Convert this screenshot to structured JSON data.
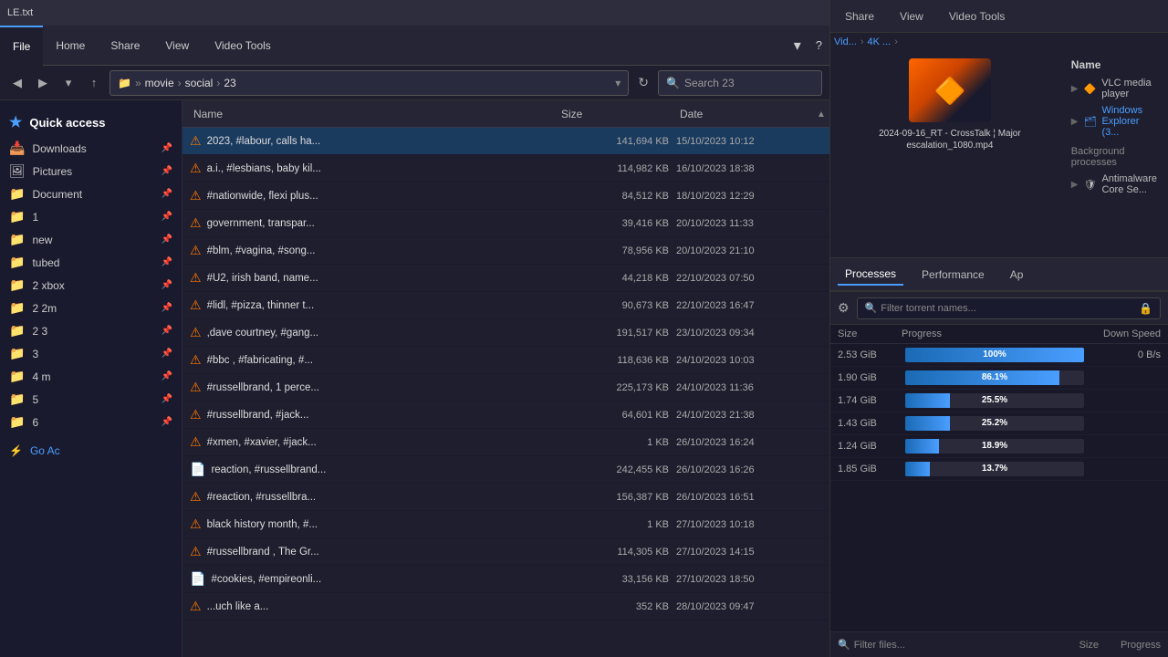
{
  "ribbon": {
    "file_tab": "File",
    "home_tab": "Home",
    "share_tab": "Share",
    "view_tab": "View",
    "videotools_tab": "Video Tools"
  },
  "addressbar": {
    "path_root": "movie",
    "path_seg1": "social",
    "path_seg2": "23",
    "search_placeholder": "Search 23",
    "search_label": "Search 23"
  },
  "sidebar": {
    "quick_access_label": "Quick access",
    "items": [
      {
        "label": "Downloads",
        "icon": "📥",
        "pinned": true
      },
      {
        "label": "Pictures",
        "icon": "🖼",
        "pinned": true
      },
      {
        "label": "Document",
        "icon": "📁",
        "pinned": true
      },
      {
        "label": "1",
        "icon": "📁",
        "pinned": true
      },
      {
        "label": "new",
        "icon": "📁",
        "pinned": true
      },
      {
        "label": "tubed",
        "icon": "📁",
        "pinned": true
      },
      {
        "label": "2 xbox",
        "icon": "📁",
        "pinned": true
      },
      {
        "label": "2 2m",
        "icon": "📁",
        "pinned": true
      },
      {
        "label": "2 3",
        "icon": "📁",
        "pinned": true
      },
      {
        "label": "3",
        "icon": "📁",
        "pinned": true
      },
      {
        "label": "4 m",
        "icon": "📁",
        "pinned": true
      },
      {
        "label": "5",
        "icon": "📁",
        "pinned": true
      },
      {
        "label": "6",
        "icon": "📁",
        "pinned": true
      }
    ],
    "go_ac_label": "Go Ac"
  },
  "file_list": {
    "col_name": "Name",
    "col_size": "Size",
    "col_date": "Date",
    "files": [
      {
        "name": "2023, #labour, calls ha...",
        "icon": "vlc",
        "size": "141,694 KB",
        "date": "15/10/2023 10:12",
        "selected": true
      },
      {
        "name": "a.i., #lesbians, baby kil...",
        "icon": "vlc",
        "size": "114,982 KB",
        "date": "16/10/2023 18:38",
        "selected": false
      },
      {
        "name": "#nationwide, flexi plus...",
        "icon": "vlc",
        "size": "84,512 KB",
        "date": "18/10/2023 12:29",
        "selected": false
      },
      {
        "name": "government, transpar...",
        "icon": "vlc",
        "size": "39,416 KB",
        "date": "20/10/2023 11:33",
        "selected": false
      },
      {
        "name": "#blm, #vagina, #song...",
        "icon": "vlc",
        "size": "78,956 KB",
        "date": "20/10/2023 21:10",
        "selected": false
      },
      {
        "name": "#U2, irish band, name...",
        "icon": "vlc",
        "size": "44,218 KB",
        "date": "22/10/2023 07:50",
        "selected": false
      },
      {
        "name": "#lidl, #pizza, thinner t...",
        "icon": "vlc",
        "size": "90,673 KB",
        "date": "22/10/2023 16:47",
        "selected": false
      },
      {
        "name": ",dave courtney, #gang...",
        "icon": "vlc",
        "size": "191,517 KB",
        "date": "23/10/2023 09:34",
        "selected": false
      },
      {
        "name": "#bbc , #fabricating, #...",
        "icon": "vlc",
        "size": "118,636 KB",
        "date": "24/10/2023 10:03",
        "selected": false
      },
      {
        "name": "#russellbrand, 1 perce...",
        "icon": "vlc",
        "size": "225,173 KB",
        "date": "24/10/2023 11:36",
        "selected": false
      },
      {
        "name": "#russellbrand, #jack...",
        "icon": "vlc",
        "size": "64,601 KB",
        "date": "24/10/2023 21:38",
        "selected": false
      },
      {
        "name": "#xmen, #xavier, #jack...",
        "icon": "vlc",
        "size": "1 KB",
        "date": "26/10/2023 16:24",
        "selected": false
      },
      {
        "name": "reaction, #russellbrand...",
        "icon": "txt",
        "size": "242,455 KB",
        "date": "26/10/2023 16:26",
        "selected": false
      },
      {
        "name": "#reaction, #russellbra...",
        "icon": "vlc",
        "size": "156,387 KB",
        "date": "26/10/2023 16:51",
        "selected": false
      },
      {
        "name": "black history month, #...",
        "icon": "vlc",
        "size": "1 KB",
        "date": "27/10/2023 10:18",
        "selected": false
      },
      {
        "name": "#russellbrand , The Gr...",
        "icon": "vlc",
        "size": "114,305 KB",
        "date": "27/10/2023 14:15",
        "selected": false
      },
      {
        "name": "#cookies, #empireonli...",
        "icon": "txt",
        "size": "33,156 KB",
        "date": "27/10/2023 18:50",
        "selected": false
      },
      {
        "name": "...uch like a...",
        "icon": "vlc",
        "size": "352 KB",
        "date": "28/10/2023 09:47",
        "selected": false
      }
    ]
  },
  "taskmanager": {
    "share_tab": "Share",
    "view_tab": "View",
    "videotools_tab": "Video Tools",
    "breadcrumb": {
      "vid": "Vid...",
      "k4": "4K ..."
    },
    "processes_tab": "Processes",
    "performance_tab": "Performance",
    "ap_tab": "Ap",
    "name_col": "Name",
    "processes": [
      {
        "label": "VLC media player",
        "icon": "🔶"
      },
      {
        "label": "Windows Explorer (3...",
        "icon": "🗂",
        "highlight": true
      }
    ],
    "bg_processes_label": "Background processes",
    "antimalware_label": "Antimalware Core Se...",
    "video_title": "2024-09-16_RT - CrossTalk ¦ Major escalation_1080.mp4"
  },
  "torrent": {
    "search_placeholder": "Filter torrent names...",
    "filter_placeholder": "Filter files...",
    "col_size": "Size",
    "col_progress": "Progress",
    "col_downspeed": "Down Speed",
    "down_speed_val": "0 B/s",
    "rows": [
      {
        "size": "2.53 GiB",
        "progress": 100,
        "progress_label": "100%"
      },
      {
        "size": "1.90 GiB",
        "progress": 86,
        "progress_label": "86.1%"
      },
      {
        "size": "1.74 GiB",
        "progress": 25,
        "progress_label": "25.5%"
      },
      {
        "size": "1.43 GiB",
        "progress": 25,
        "progress_label": "25.2%"
      },
      {
        "size": "1.24 GiB",
        "progress": 19,
        "progress_label": "18.9%"
      },
      {
        "size": "1.85 GiB",
        "progress": 14,
        "progress_label": "13.7%"
      }
    ]
  }
}
